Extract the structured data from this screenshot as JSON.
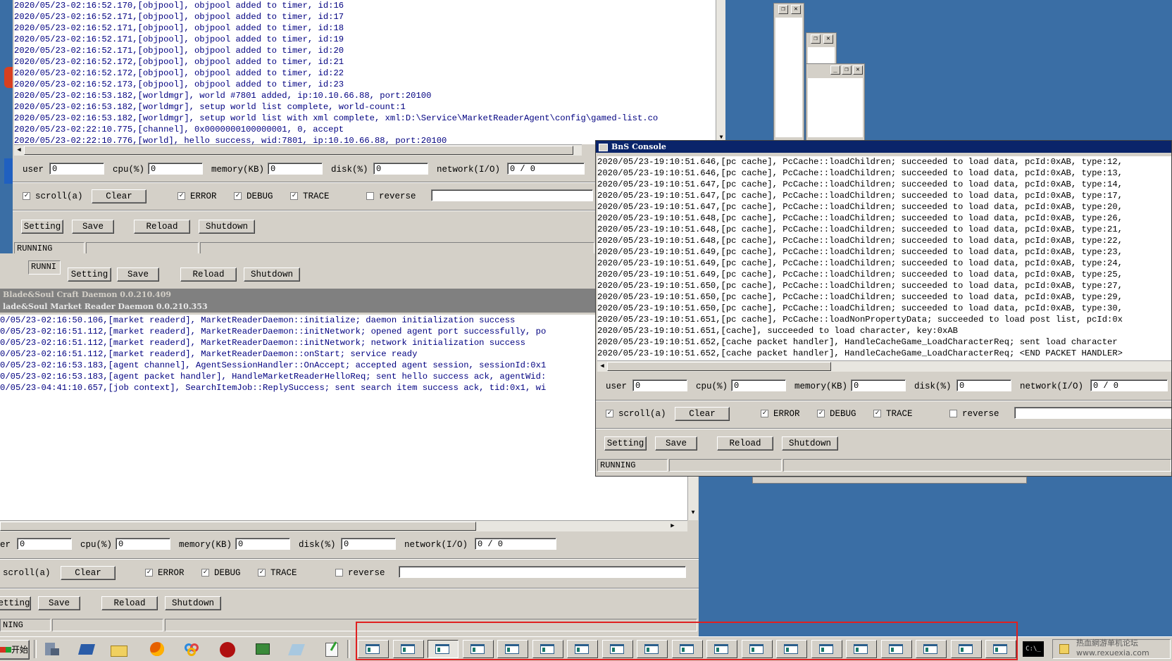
{
  "top_window": {
    "log_lines": [
      "2020/05/23-02:16:52.170,[objpool], objpool added to timer, id:16",
      "2020/05/23-02:16:52.171,[objpool], objpool added to timer, id:17",
      "2020/05/23-02:16:52.171,[objpool], objpool added to timer, id:18",
      "2020/05/23-02:16:52.171,[objpool], objpool added to timer, id:19",
      "2020/05/23-02:16:52.171,[objpool], objpool added to timer, id:20",
      "2020/05/23-02:16:52.172,[objpool], objpool added to timer, id:21",
      "2020/05/23-02:16:52.172,[objpool], objpool added to timer, id:22",
      "2020/05/23-02:16:52.173,[objpool], objpool added to timer, id:23",
      "2020/05/23-02:16:53.182,[worldmgr], world #7801 added, ip:10.10.66.88, port:20100",
      "2020/05/23-02:16:53.182,[worldmgr], setup world list complete, world-count:1",
      "2020/05/23-02:16:53.182,[worldmgr], setup world list with xml complete, xml:D:\\Service\\MarketReaderAgent\\config\\gamed-list.co",
      "2020/05/23-02:22:10.775,[channel], 0x0000000100000001, 0, accept",
      "2020/05/23-02:22:10.776,[world], hello success, wid:7801, ip:10.10.66.88, port:20100"
    ],
    "stats": {
      "user_label": "user",
      "user": "0",
      "cpu_label": "cpu(%)",
      "cpu": "0",
      "mem_label": "memory(KB)",
      "mem": "0",
      "disk_label": "disk(%)",
      "disk": "0",
      "net_label": "network(I/O)",
      "net": "0 / 0"
    },
    "opts": {
      "scroll": "scroll(a)",
      "clear": "Clear",
      "error": "ERROR",
      "debug": "DEBUG",
      "trace": "TRACE",
      "reverse": "reverse"
    },
    "buttons": {
      "setting": "Setting",
      "save": "Save",
      "reload": "Reload",
      "shutdown": "Shutdown"
    },
    "status": "RUNNING"
  },
  "second_window": {
    "status": "RUNNI",
    "buttons": {
      "setting": "Setting",
      "save": "Save",
      "reload": "Reload",
      "shutdown": "Shutdown"
    }
  },
  "craft_title": "Blade&Soul Craft Daemon 0.0.210.409",
  "market_window": {
    "title": "lade&Soul Market Reader Daemon 0.0.210.353",
    "log_lines": [
      "0/05/23-02:16:50.106,[market readerd], MarketReaderDaemon::initialize; daemon initialization success",
      "0/05/23-02:16:51.112,[market readerd], MarketReaderDaemon::initNetwork; opened agent port successfully, po",
      "0/05/23-02:16:51.112,[market readerd], MarketReaderDaemon::initNetwork; network initialization success",
      "0/05/23-02:16:51.112,[market readerd], MarketReaderDaemon::onStart; service ready",
      "0/05/23-02:16:53.183,[agent channel], AgentSessionHandler::OnAccept; accepted agent session, sessionId:0x1",
      "0/05/23-02:16:53.183,[agent packet handler], HandleMarketReaderHelloReq; sent hello success ack, agentWid:",
      "0/05/23-04:41:10.657,[job context], SearchItemJob::ReplySuccess; sent search item success ack, tid:0x1, wi"
    ],
    "stats": {
      "user_label": "er",
      "user": "0",
      "cpu_label": "cpu(%)",
      "cpu": "0",
      "mem_label": "memory(KB)",
      "mem": "0",
      "disk_label": "disk(%)",
      "disk": "0",
      "net_label": "network(I/O)",
      "net": "0 / 0"
    },
    "opts": {
      "scroll": "scroll(a)",
      "clear": "Clear",
      "error": "ERROR",
      "debug": "DEBUG",
      "trace": "TRACE",
      "reverse": "reverse"
    },
    "buttons": {
      "setting": "etting",
      "save": "Save",
      "reload": "Reload",
      "shutdown": "Shutdown"
    },
    "status": "NING"
  },
  "bns_console": {
    "title": "BnS Console",
    "log_lines": [
      "2020/05/23-19:10:51.646,[pc cache], PcCache::loadChildren; succeeded to load data, pcId:0xAB, type:12,",
      "2020/05/23-19:10:51.646,[pc cache], PcCache::loadChildren; succeeded to load data, pcId:0xAB, type:13,",
      "2020/05/23-19:10:51.647,[pc cache], PcCache::loadChildren; succeeded to load data, pcId:0xAB, type:14,",
      "2020/05/23-19:10:51.647,[pc cache], PcCache::loadChildren; succeeded to load data, pcId:0xAB, type:17,",
      "2020/05/23-19:10:51.647,[pc cache], PcCache::loadChildren; succeeded to load data, pcId:0xAB, type:20,",
      "2020/05/23-19:10:51.648,[pc cache], PcCache::loadChildren; succeeded to load data, pcId:0xAB, type:26,",
      "2020/05/23-19:10:51.648,[pc cache], PcCache::loadChildren; succeeded to load data, pcId:0xAB, type:21,",
      "2020/05/23-19:10:51.648,[pc cache], PcCache::loadChildren; succeeded to load data, pcId:0xAB, type:22,",
      "2020/05/23-19:10:51.649,[pc cache], PcCache::loadChildren; succeeded to load data, pcId:0xAB, type:23,",
      "2020/05/23-19:10:51.649,[pc cache], PcCache::loadChildren; succeeded to load data, pcId:0xAB, type:24,",
      "2020/05/23-19:10:51.649,[pc cache], PcCache::loadChildren; succeeded to load data, pcId:0xAB, type:25,",
      "2020/05/23-19:10:51.650,[pc cache], PcCache::loadChildren; succeeded to load data, pcId:0xAB, type:27,",
      "2020/05/23-19:10:51.650,[pc cache], PcCache::loadChildren; succeeded to load data, pcId:0xAB, type:29,",
      "2020/05/23-19:10:51.650,[pc cache], PcCache::loadChildren; succeeded to load data, pcId:0xAB, type:30,",
      "2020/05/23-19:10:51.651,[pc cache], PcCache::loadNonPropertyData; succeeded to load post list, pcId:0x",
      "2020/05/23-19:10:51.651,[cache], succeeded to load character, key:0xAB",
      "2020/05/23-19:10:51.652,[cache packet handler], HandleCacheGame_LoadCharacterReq; sent load character",
      "2020/05/23-19:10:51.652,[cache packet handler], HandleCacheGame_LoadCharacterReq; <END PACKET HANDLER>"
    ],
    "stats": {
      "user_label": "user",
      "user": "0",
      "cpu_label": "cpu(%)",
      "cpu": "0",
      "mem_label": "memory(KB)",
      "mem": "0",
      "disk_label": "disk(%)",
      "disk": "0",
      "net_label": "network(I/O)",
      "net": "0 / 0"
    },
    "opts": {
      "scroll": "scroll(a)",
      "clear": "Clear",
      "error": "ERROR",
      "debug": "DEBUG",
      "trace": "TRACE",
      "reverse": "reverse"
    },
    "buttons": {
      "setting": "Setting",
      "save": "Save",
      "reload": "Reload",
      "shutdown": "Shutdown"
    },
    "status": "RUNNING"
  },
  "taskbar": {
    "start_label": "开始",
    "quick_launch_icons": [
      "server-manager-icon",
      "powershell-icon",
      "folder-icon",
      "firefox-icon",
      "baidu-netdisk-icon",
      "game-icon",
      "network-icon",
      "notepad-icon",
      "app-icon"
    ],
    "window_button_count": 19,
    "cmd_icon_label": "C:\\_",
    "watermark": "热血網游单机论坛 www.rexuexia.com",
    "highlight_color": "#e02020"
  },
  "colors": {
    "desktop": "#3a6ea5",
    "titlebar_active": "#0a246a",
    "titlebar_inactive": "#808080",
    "log_blue": "#000080"
  }
}
